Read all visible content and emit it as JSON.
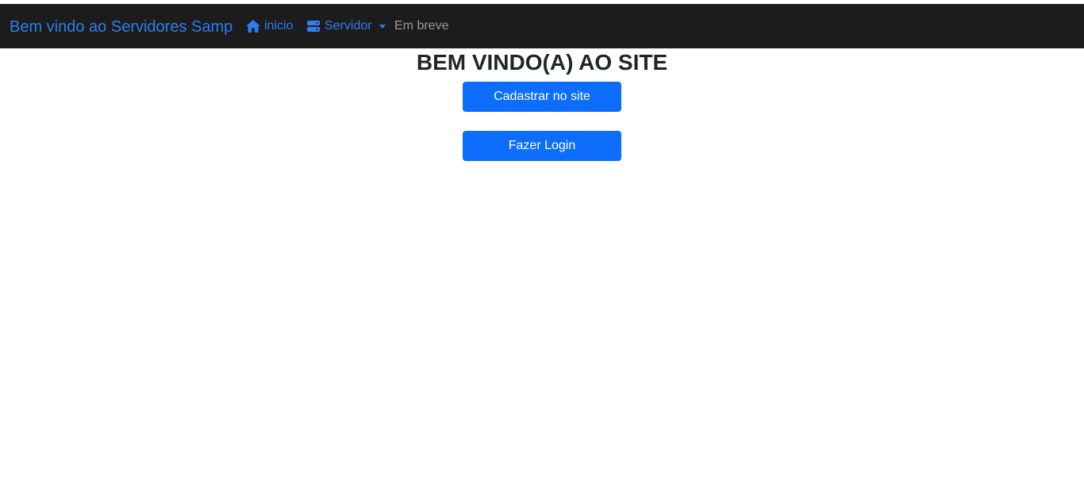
{
  "navbar": {
    "brand": "Bem vindo ao Servidores Samp",
    "items": [
      {
        "label": "inicio",
        "icon": "home-icon",
        "color": "#2d7ff0"
      },
      {
        "label": "Servidor",
        "icon": "server-icon",
        "color": "#2d7ff0",
        "dropdown": true
      },
      {
        "label": "Em breve",
        "color": "#9a9a9a"
      }
    ],
    "background": "#1c1c1c"
  },
  "main": {
    "heading": "BEM VINDO(A) AO SITE",
    "buttons": {
      "register": "Cadastrar no site",
      "login": "Fazer Login"
    },
    "button_color": "#0d6efd"
  }
}
